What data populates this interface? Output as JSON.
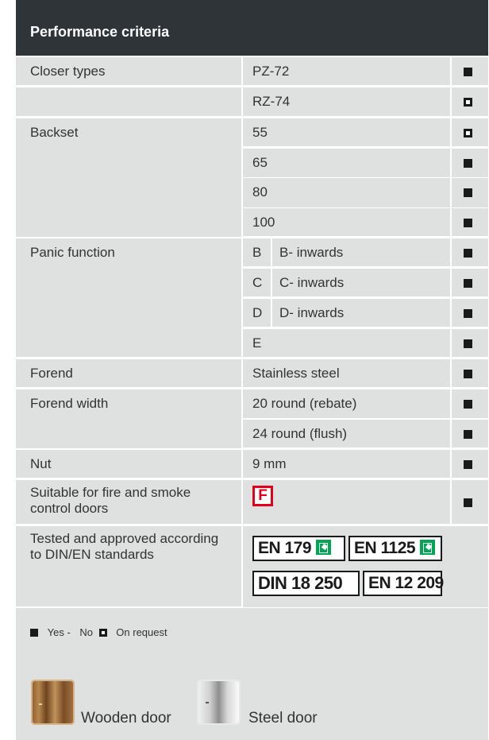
{
  "header": {
    "title": "Performance criteria"
  },
  "colors": {
    "header_bg": "#2e3438",
    "cell_bg": "#dfe0e0",
    "fire_red": "#e2001a",
    "exit_green": "#00a651"
  },
  "rows": [
    {
      "label": "Closer types",
      "value": "PZ-72",
      "status": "yes"
    },
    {
      "label": "",
      "value": "RZ-74",
      "status": "on_request"
    },
    {
      "label": "Backset",
      "value": "55",
      "status": "on_request"
    },
    {
      "label": "",
      "value": "65",
      "status": "yes"
    },
    {
      "label": "",
      "value": "80",
      "status": "yes"
    },
    {
      "label": "",
      "value": "100",
      "status": "yes"
    },
    {
      "label": "Panic function",
      "code": "B",
      "value": "B- inwards",
      "status": "yes"
    },
    {
      "label": "",
      "code": "C",
      "value": "C- inwards",
      "status": "yes"
    },
    {
      "label": "",
      "code": "D",
      "value": "D- inwards",
      "status": "yes"
    },
    {
      "label": "",
      "value": "E",
      "status": "yes"
    },
    {
      "label": "Forend",
      "value": "Stainless steel",
      "status": "yes"
    },
    {
      "label": "Forend width",
      "value": "20 round (rebate)",
      "status": "yes"
    },
    {
      "label": "",
      "value": "24 round (flush)",
      "status": "yes"
    },
    {
      "label": "Nut",
      "value": "9 mm",
      "status": "yes"
    },
    {
      "label": "Suitable for fire and smoke control doors",
      "badge": "F",
      "status": "yes"
    },
    {
      "label": "Tested and approved according to DIN/EN standards"
    }
  ],
  "standards": [
    "EN 179",
    "EN 1125",
    "DIN 18 250",
    "EN 12 209"
  ],
  "legend": {
    "yes": "Yes -",
    "no": "No",
    "on_request": "On request"
  },
  "doors": {
    "wooden": "Wooden door",
    "steel": "Steel door"
  }
}
